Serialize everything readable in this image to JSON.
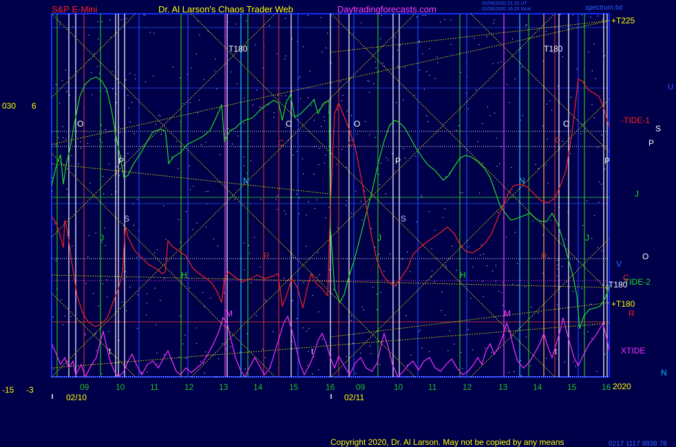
{
  "header": {
    "symbol": "S&P E-Mini",
    "site_title": "Dr. Al Larson's Chaos Trader Web",
    "site_url": "Daytradingforecasts.com",
    "stamp_line1": "02/09/2020 21:20 UT",
    "stamp_line2": "02/09/2020 16:20 local",
    "spectrum_label": "spectrum.txt"
  },
  "footer": {
    "copyright": "Copyright 2020, Dr. Al Larson. May not be copied by any means",
    "stamp": "0217 1117 8838 78"
  },
  "chart_data": {
    "type": "line",
    "title": "Chaos Trader Web",
    "left_axis": {
      "top_labels": [
        "030",
        "6"
      ],
      "bottom_labels": [
        "-15",
        "-3"
      ]
    },
    "x_axis": {
      "date_labels": [
        "02/10",
        "02/11"
      ],
      "hour_labels": [
        "09",
        "10",
        "11",
        "12",
        "13",
        "14",
        "15",
        "16",
        "09",
        "10",
        "11",
        "12",
        "13",
        "14",
        "15",
        "16"
      ]
    },
    "series": [
      {
        "name": "-TIDE-1",
        "color": "#ff2020"
      },
      {
        "name": "TIDE-2",
        "color": "#20e020"
      },
      {
        "name": "XTIDE",
        "color": "#ff30ff"
      }
    ],
    "right_labels": [
      {
        "text": "+T225",
        "color": "#ffff00"
      },
      {
        "text": "-TIDE-1",
        "color": "#ff2020"
      },
      {
        "text": "-T180",
        "color": "#ffffff"
      },
      {
        "text": "TIDE-2",
        "color": "#20e020"
      },
      {
        "text": "+T180",
        "color": "#ffff00"
      },
      {
        "text": "XTIDE",
        "color": "#ff30ff"
      },
      {
        "text": "2020",
        "color": "#ffff00"
      }
    ],
    "planet_labels": [
      {
        "text": "U",
        "color": "#3050ff"
      },
      {
        "text": "S",
        "color": "#ffffff"
      },
      {
        "text": "P",
        "color": "#ffffff"
      },
      {
        "text": "J",
        "color": "#20e020"
      },
      {
        "text": "O",
        "color": "#ffffff"
      },
      {
        "text": "V",
        "color": "#3060ff"
      },
      {
        "text": "C",
        "color": "#ff2020"
      },
      {
        "text": "R",
        "color": "#ff2020"
      },
      {
        "text": "N",
        "color": "#00c0ff"
      }
    ],
    "chart_markers": {
      "t180": "T180",
      "letters": [
        "O",
        "P",
        "S",
        "J",
        "H",
        "N",
        "M",
        "C",
        "R",
        "t"
      ]
    }
  }
}
